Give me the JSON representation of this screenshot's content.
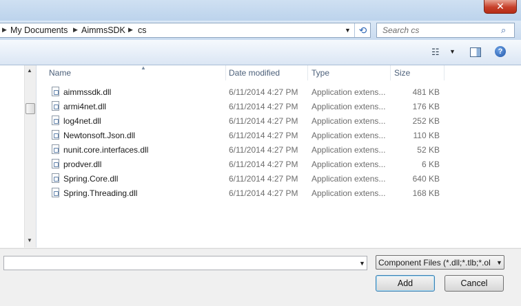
{
  "window": {
    "close_label": "✕"
  },
  "address": {
    "crumbs": [
      "My Documents",
      "AimmsSDK",
      "cs"
    ],
    "search_placeholder": "Search cs"
  },
  "file_list": {
    "columns": {
      "name": "Name",
      "date": "Date modified",
      "type": "Type",
      "size": "Size"
    },
    "rows": [
      {
        "name": "aimmssdk.dll",
        "date": "6/11/2014 4:27 PM",
        "type": "Application extens...",
        "size": "481 KB"
      },
      {
        "name": "armi4net.dll",
        "date": "6/11/2014 4:27 PM",
        "type": "Application extens...",
        "size": "176 KB"
      },
      {
        "name": "log4net.dll",
        "date": "6/11/2014 4:27 PM",
        "type": "Application extens...",
        "size": "252 KB"
      },
      {
        "name": "Newtonsoft.Json.dll",
        "date": "6/11/2014 4:27 PM",
        "type": "Application extens...",
        "size": "110 KB"
      },
      {
        "name": "nunit.core.interfaces.dll",
        "date": "6/11/2014 4:27 PM",
        "type": "Application extens...",
        "size": "52 KB"
      },
      {
        "name": "prodver.dll",
        "date": "6/11/2014 4:27 PM",
        "type": "Application extens...",
        "size": "6 KB"
      },
      {
        "name": "Spring.Core.dll",
        "date": "6/11/2014 4:27 PM",
        "type": "Application extens...",
        "size": "640 KB"
      },
      {
        "name": "Spring.Threading.dll",
        "date": "6/11/2014 4:27 PM",
        "type": "Application extens...",
        "size": "168 KB"
      }
    ]
  },
  "bottom": {
    "filename_value": "",
    "filter_value": "Component Files (*.dll;*.tlb;*.ol",
    "add_label": "Add",
    "cancel_label": "Cancel"
  }
}
